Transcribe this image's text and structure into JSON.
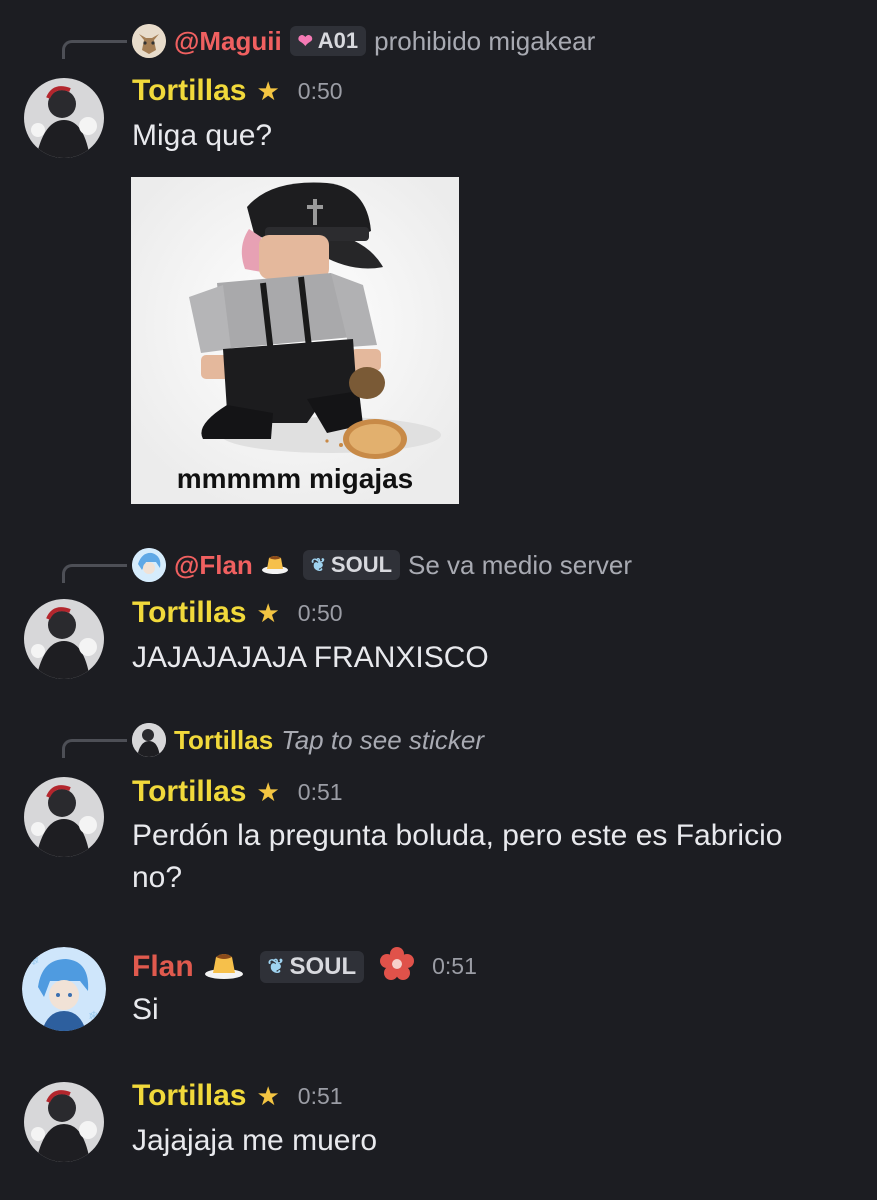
{
  "colors": {
    "background": "#1c1d22",
    "tortillas_name": "#f1d93b",
    "maguii_mention": "#f06060",
    "flan_name": "#e05a4e",
    "muted": "#a8aab2"
  },
  "messages": [
    {
      "reply": {
        "author": "@Maguii",
        "badge": "A01",
        "badge_icon": "heart-icon",
        "text": "prohibido migakear"
      },
      "author": "Tortillas",
      "role_icon": "star-icon",
      "time": "0:50",
      "text": "Miga que?",
      "attachment": {
        "caption": "mmmmm migajas"
      }
    },
    {
      "reply": {
        "author": "@Flan",
        "author_icon": "flan-pudding-icon",
        "badge": "SOUL",
        "badge_icon": "leaf-icon",
        "text": "Se va medio server"
      },
      "author": "Tortillas",
      "role_icon": "star-icon",
      "time": "0:50",
      "text": "JAJAJAJAJA FRANXISCO"
    },
    {
      "reply": {
        "author": "Tortillas",
        "text": "Tap to see sticker"
      },
      "author": "Tortillas",
      "role_icon": "star-icon",
      "time": "0:51",
      "text_line1": "Perdón la pregunta boluda, pero este es Fabricio",
      "text_line2": "no?"
    },
    {
      "author": "Flan",
      "author_icon": "flan-pudding-icon",
      "badge": "SOUL",
      "badge_icon": "leaf-icon",
      "extra_icon": "flower-icon",
      "time": "0:51",
      "text": "Si"
    },
    {
      "author": "Tortillas",
      "role_icon": "star-icon",
      "time": "0:51",
      "text": "Jajajaja me muero"
    }
  ]
}
